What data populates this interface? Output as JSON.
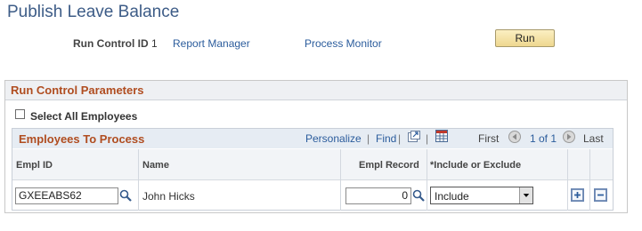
{
  "page": {
    "title": "Publish Leave Balance"
  },
  "run_control": {
    "label": "Run Control ID",
    "value": "1",
    "report_manager": "Report Manager",
    "process_monitor": "Process Monitor",
    "run_button": "Run"
  },
  "parameters": {
    "title": "Run Control Parameters",
    "select_all_label": "Select All Employees",
    "select_all_checked": false
  },
  "grid": {
    "title": "Employees To Process",
    "personalize": "Personalize",
    "separator": "|",
    "find": "Find",
    "first": "First",
    "count": "1 of 1",
    "last": "Last",
    "columns": [
      "Empl ID",
      "Name",
      "Empl Record",
      "*Include or Exclude"
    ],
    "rows": [
      {
        "emplid": "GXEEABS62",
        "name": "John Hicks",
        "empl_record": "0",
        "include_exclude": "Include"
      }
    ]
  },
  "icons": [
    "lookup-icon",
    "view-all-icon",
    "download-icon",
    "prev-icon",
    "next-icon",
    "add-row-icon",
    "delete-row-icon",
    "dropdown-arrow-icon"
  ],
  "colors": {
    "title": "#3d5c87",
    "section_title": "#b04d20",
    "link": "#2b5c9c",
    "run_button": "#eed78f"
  }
}
